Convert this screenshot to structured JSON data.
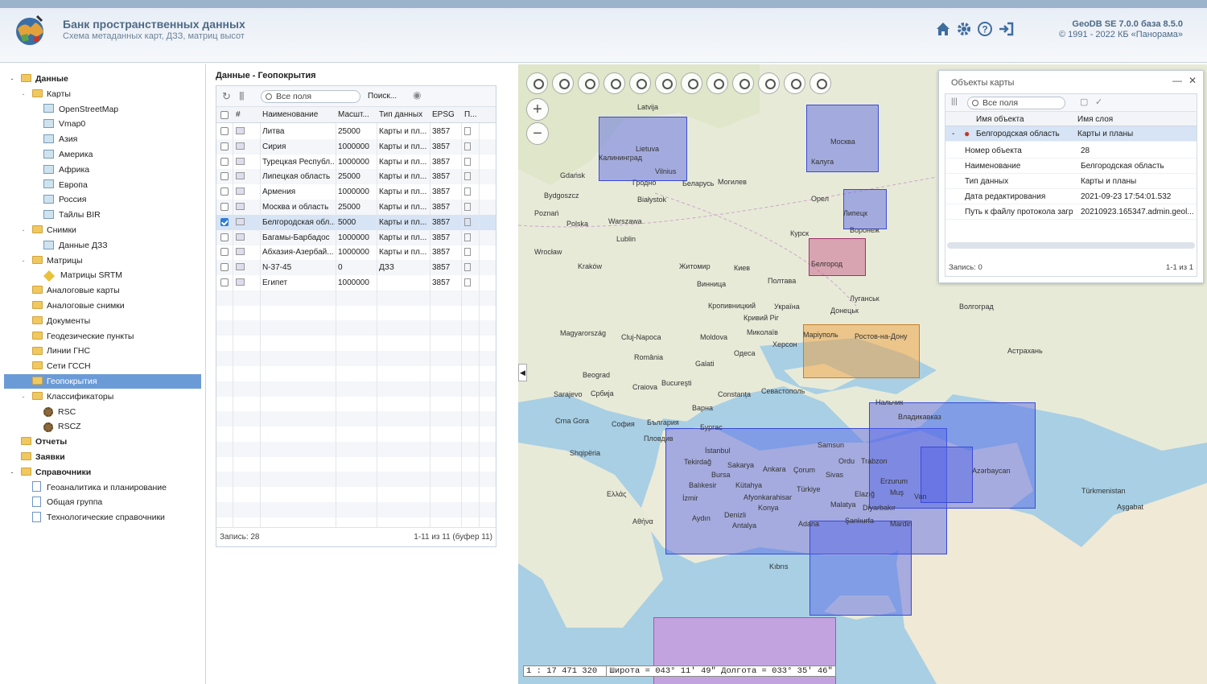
{
  "header": {
    "title": "Банк пространственных данных",
    "subtitle": "Схема метаданных карт, ДЗЗ, матриц высот",
    "version": "GeoDB SE 7.0.0 база 8.5.0",
    "copyright": "© 1991 - 2022 КБ «Панорама»",
    "icons": [
      "home-icon",
      "gear-icon",
      "help-icon",
      "logout-icon"
    ]
  },
  "tree": [
    {
      "label": "Данные",
      "level": 0,
      "tog": "-",
      "icon": "folder",
      "bold": true
    },
    {
      "label": "Карты",
      "level": 1,
      "tog": "-",
      "icon": "folder"
    },
    {
      "label": "OpenStreetMap",
      "level": 2,
      "icon": "map"
    },
    {
      "label": "Vmap0",
      "level": 2,
      "icon": "map"
    },
    {
      "label": "Азия",
      "level": 2,
      "icon": "map"
    },
    {
      "label": "Америка",
      "level": 2,
      "icon": "map"
    },
    {
      "label": "Африка",
      "level": 2,
      "icon": "map"
    },
    {
      "label": "Европа",
      "level": 2,
      "icon": "map"
    },
    {
      "label": "Россия",
      "level": 2,
      "icon": "map"
    },
    {
      "label": "Тайлы BIR",
      "level": 2,
      "icon": "map"
    },
    {
      "label": "Снимки",
      "level": 1,
      "tog": "-",
      "icon": "folder"
    },
    {
      "label": "Данные ДЗЗ",
      "level": 2,
      "icon": "map"
    },
    {
      "label": "Матрицы",
      "level": 1,
      "tog": "-",
      "icon": "folder"
    },
    {
      "label": "Матрицы SRTM",
      "level": 2,
      "icon": "diamond"
    },
    {
      "label": "Аналоговые карты",
      "level": 1,
      "icon": "folder"
    },
    {
      "label": "Аналоговые снимки",
      "level": 1,
      "icon": "folder"
    },
    {
      "label": "Документы",
      "level": 1,
      "icon": "folder"
    },
    {
      "label": "Геодезические пункты",
      "level": 1,
      "icon": "folder"
    },
    {
      "label": "Линии ГНС",
      "level": 1,
      "icon": "folder"
    },
    {
      "label": "Сети ГССН",
      "level": 1,
      "icon": "folder"
    },
    {
      "label": "Геопокрытия",
      "level": 1,
      "icon": "folder",
      "selected": true
    },
    {
      "label": "Классификаторы",
      "level": 1,
      "tog": "-",
      "icon": "folder"
    },
    {
      "label": "RSC",
      "level": 2,
      "icon": "gear"
    },
    {
      "label": "RSCZ",
      "level": 2,
      "icon": "gear"
    },
    {
      "label": "Отчеты",
      "level": 0,
      "icon": "folder",
      "bold": true
    },
    {
      "label": "Заявки",
      "level": 0,
      "icon": "folder",
      "bold": true
    },
    {
      "label": "Справочники",
      "level": 0,
      "tog": "-",
      "icon": "folder",
      "bold": true
    },
    {
      "label": "Геоаналитика и планирование",
      "level": 1,
      "icon": "doc"
    },
    {
      "label": "Общая группа",
      "level": 1,
      "icon": "doc"
    },
    {
      "label": "Технологические справочники",
      "level": 1,
      "icon": "doc"
    }
  ],
  "grid": {
    "title": "Данные - Геопокрытия",
    "search_placeholder": "Все поля",
    "search_button": "Поиск...",
    "columns": [
      "#",
      "Наименование",
      "Масшт...",
      "Тип данных",
      "EPSG",
      "П..."
    ],
    "rows": [
      {
        "name": "Литва",
        "scale": "25000",
        "type": "Карты и пл...",
        "epsg": "3857"
      },
      {
        "name": "Сирия",
        "scale": "1000000",
        "type": "Карты и пл...",
        "epsg": "3857"
      },
      {
        "name": "Турецкая Республ...",
        "scale": "1000000",
        "type": "Карты и пл...",
        "epsg": "3857"
      },
      {
        "name": "Липецкая область",
        "scale": "25000",
        "type": "Карты и пл...",
        "epsg": "3857"
      },
      {
        "name": "Армения",
        "scale": "1000000",
        "type": "Карты и пл...",
        "epsg": "3857"
      },
      {
        "name": "Москва и область",
        "scale": "25000",
        "type": "Карты и пл...",
        "epsg": "3857"
      },
      {
        "name": "Белгородская обл...",
        "scale": "5000",
        "type": "Карты и пл...",
        "epsg": "3857",
        "checked": true
      },
      {
        "name": "Багамы-Барбадос",
        "scale": "1000000",
        "type": "Карты и пл...",
        "epsg": "3857"
      },
      {
        "name": "Абхазия-Азербай...",
        "scale": "1000000",
        "type": "Карты и пл...",
        "epsg": "3857"
      },
      {
        "name": "N-37-45",
        "scale": "0",
        "type": "ДЗЗ",
        "epsg": "3857"
      },
      {
        "name": "Египет",
        "scale": "1000000",
        "type": "",
        "epsg": "3857"
      }
    ],
    "footer_left": "Запись: 28",
    "footer_right": "1-11 из 11 (буфер 11)"
  },
  "map": {
    "scale": "1 : 17 471 320",
    "coords": "Широта = 043° 11' 49\" Долгота = 033° 35' 46\"",
    "zoom_in": "+",
    "zoom_out": "−",
    "collapse": "◀",
    "toolbar": [
      "zoom-in-icon",
      "zoom-out-icon",
      "zoom-icon",
      "zoom-region-icon",
      "zoom-reset-icon",
      "layers-icon",
      "ruler-icon",
      "table-icon",
      "print-icon",
      "image-icon",
      "export-icon",
      "settings-icon"
    ],
    "cities": [
      "Latvija",
      "Lietuva",
      "Калининград",
      "Vilnius",
      "Гродно",
      "Gdańsk",
      "Białystok",
      "Bydgoszcz",
      "Poznań",
      "Polska",
      "Warszawa",
      "Lublin",
      "Wrocław",
      "Kraków",
      "Беларусь",
      "Могилев",
      "Москва",
      "Калуга",
      "Липецк",
      "Воронеж",
      "Орел",
      "Курск",
      "Белгород",
      "Житомир",
      "Киев",
      "Полтава",
      "Винница",
      "Україна",
      "Луганськ",
      "Донецьк",
      "Волгоград",
      "Кропивницкий",
      "Кривий Ріг",
      "Маріуполь",
      "Ростов-на-Дону",
      "Миколаїв",
      "Херсон",
      "Одеса",
      "Астрахань",
      "Moldova",
      "Cluj-Napoca",
      "România",
      "Magyarország",
      "Galati",
      "Bucureşti",
      "Constanța",
      "Beograd",
      "Србија",
      "Craiova",
      "Севастополь",
      "Варна",
      "България",
      "София",
      "Пловдив",
      "Бургас",
      "Sarajevo",
      "Crna Gora",
      "Shqipëria",
      "Ελλάς",
      "Αθήνα",
      "İstanbul",
      "Bursa",
      "Tekirdağ",
      "Sakarya",
      "Ankara",
      "Çorum",
      "Samsun",
      "Ordu",
      "Trabzon",
      "Sivas",
      "Türkiye",
      "Kütahya",
      "Balıkesir",
      "Afyonkarahisar",
      "Konya",
      "İzmir",
      "Aydın",
      "Denizli",
      "Antalya",
      "Adana",
      "Malatya",
      "Elazığ",
      "Muş",
      "Erzurum",
      "Van",
      "Şanlıurfa",
      "Diyarbakır",
      "Mardin",
      "Azərbaycan",
      "Владикавказ",
      "Нальчик",
      "Kıbrıs",
      "Türkmenistan",
      "Aşgabat"
    ]
  },
  "objects": {
    "title": "Объекты карты",
    "search_placeholder": "Все поля",
    "columns": [
      "Имя объекта",
      "Имя слоя"
    ],
    "selected": {
      "name": "Белгородская область",
      "layer": "Карты и планы"
    },
    "props": [
      {
        "k": "Номер объекта",
        "v": "28"
      },
      {
        "k": "Наименование",
        "v": "Белгородская область"
      },
      {
        "k": "Тип данных",
        "v": "Карты и планы"
      },
      {
        "k": "Дата редактирования",
        "v": "2021-09-23 17:54:01.532"
      },
      {
        "k": "Путь к файлу протокола загр...",
        "v": "20210923.165347.admin.geol..."
      }
    ],
    "footer_left": "Запись: 0",
    "footer_right": "1-1 из 1"
  }
}
